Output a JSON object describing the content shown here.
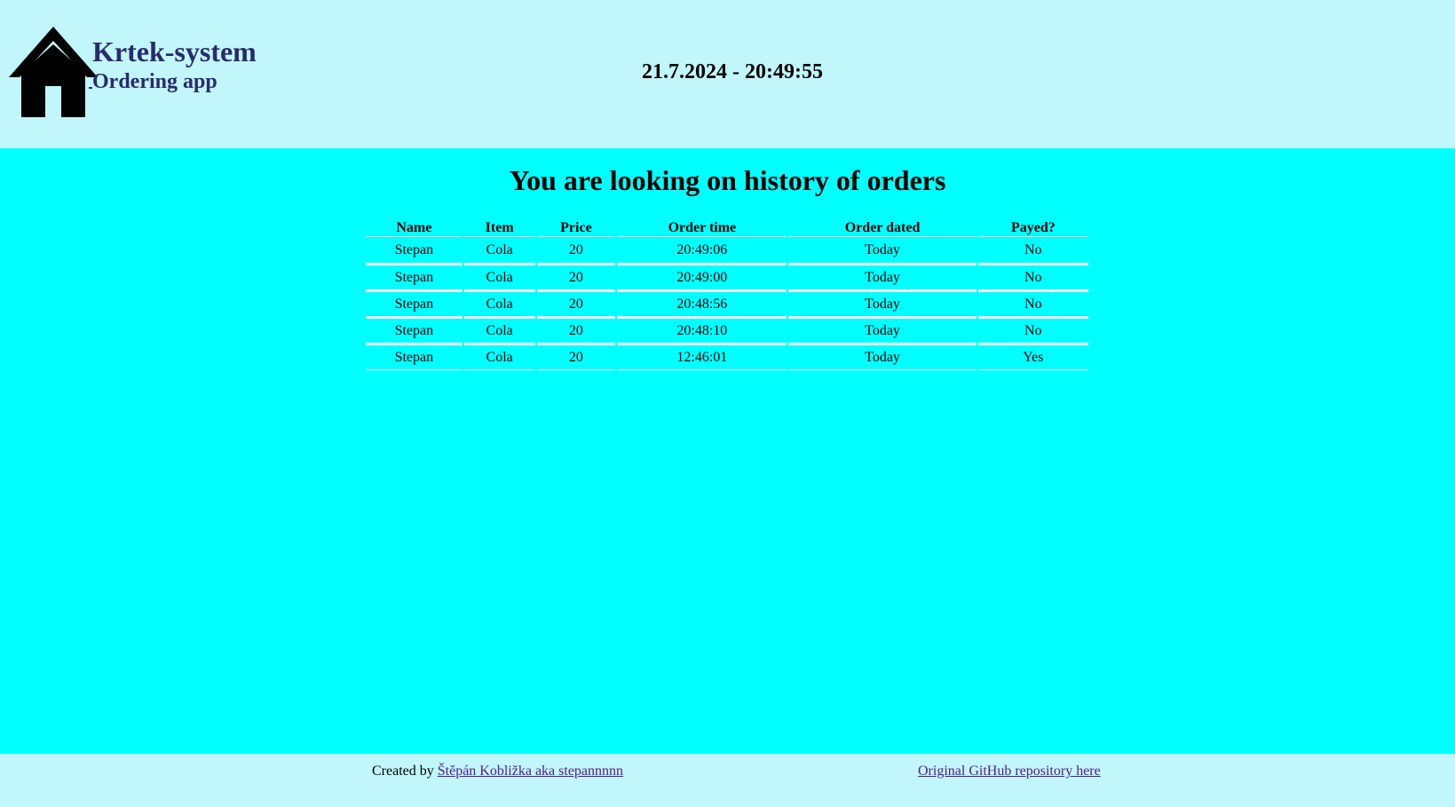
{
  "header": {
    "brand_title": "Krtek-system",
    "brand_subtitle": "Ordering app",
    "home_icon": "house-icon",
    "datetime": "21.7.2024 - 20:49:55"
  },
  "main": {
    "heading": "You are looking on history of orders",
    "table": {
      "columns": [
        "Name",
        "Item",
        "Price",
        "Order time",
        "Order dated",
        "Payed?"
      ],
      "rows": [
        [
          "Stepan",
          "Cola",
          "20",
          "20:49:06",
          "Today",
          "No"
        ],
        [
          "Stepan",
          "Cola",
          "20",
          "20:49:00",
          "Today",
          "No"
        ],
        [
          "Stepan",
          "Cola",
          "20",
          "20:48:56",
          "Today",
          "No"
        ],
        [
          "Stepan",
          "Cola",
          "20",
          "20:48:10",
          "Today",
          "No"
        ],
        [
          "Stepan",
          "Cola",
          "20",
          "12:46:01",
          "Today",
          "Yes"
        ]
      ]
    }
  },
  "footer": {
    "created_by_text": "Created by ",
    "author_link": "Štěpán Kobližka aka stepannnnn ",
    "repo_link": "Original GitHub repository here"
  },
  "colors": {
    "header_bg": "#c1f6fa",
    "main_bg": "#00ffff",
    "brand_text": "#2a2a70",
    "link": "#551a8b"
  }
}
